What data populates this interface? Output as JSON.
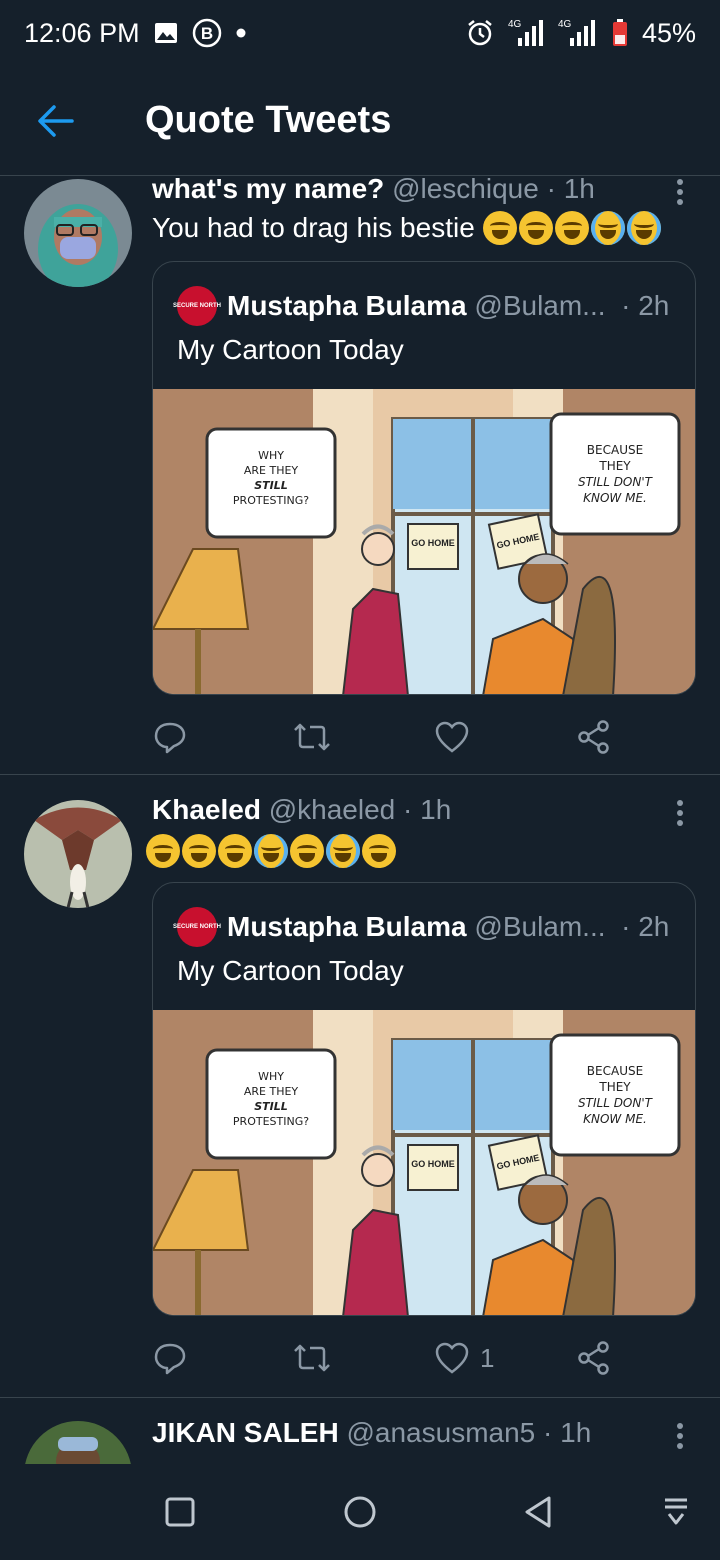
{
  "status_bar": {
    "time": "12:06 PM",
    "battery": "45%",
    "net1": "4G",
    "net2": "4G",
    "icons": [
      "gallery-icon",
      "b-icon",
      "dot-icon",
      "alarm-icon",
      "signal-icon",
      "battery-icon"
    ]
  },
  "header": {
    "title": "Quote Tweets",
    "back_icon": "arrow-left-icon",
    "accent": "#1d9bf0"
  },
  "tweets": [
    {
      "name": "what's my name?",
      "handle": "@leschique",
      "time": "· 1h",
      "text": "You had to drag his bestie",
      "emojis": [
        "rofl",
        "rofl",
        "rofl",
        "cry",
        "cry"
      ],
      "quote": {
        "name": "Mustapha Bulama",
        "handle": "@Bulam...",
        "time": "· 2h",
        "text": "My Cartoon Today",
        "avatar_text": "SECURE NORTH",
        "image": {
          "bubble_left": [
            "WHY",
            "ARE THEY",
            "STILL",
            "PROTESTING?"
          ],
          "bubble_right": [
            "BECAUSE",
            "THEY",
            "STILL DON'T",
            "KNOW ME."
          ],
          "sign1": "GO HOME",
          "sign2": "GO HOME"
        }
      },
      "likes": ""
    },
    {
      "name": "Khaeled",
      "handle": "@khaeled",
      "time": "· 1h",
      "text": "",
      "emojis": [
        "rofl",
        "rofl",
        "rofl",
        "joy",
        "rofl",
        "joy",
        "rofl"
      ],
      "quote": {
        "name": "Mustapha Bulama",
        "handle": "@Bulam...",
        "time": "· 2h",
        "text": "My Cartoon Today",
        "avatar_text": "SECURE NORTH",
        "image": {
          "bubble_left": [
            "WHY",
            "ARE THEY",
            "STILL",
            "PROTESTING?"
          ],
          "bubble_right": [
            "BECAUSE",
            "THEY",
            "STILL DON'T",
            "KNOW ME."
          ],
          "sign1": "GO HOME",
          "sign2": "GO HOME"
        }
      },
      "likes": "1"
    },
    {
      "name": "JIKAN SALEH",
      "handle": "@anasusman5",
      "time": "· 1h"
    }
  ],
  "nav_bar": {
    "icons": [
      "recents-square-icon",
      "home-circle-icon",
      "back-triangle-icon",
      "notification-pull-icon"
    ]
  }
}
